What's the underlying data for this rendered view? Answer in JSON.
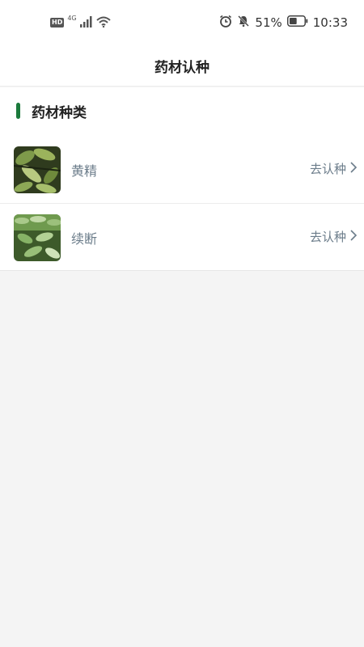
{
  "status_bar": {
    "hd": "HD",
    "network": "4G",
    "battery_percent": "51%",
    "time": "10:33",
    "battery_level": 0.51
  },
  "header": {
    "title": "药材认种"
  },
  "section": {
    "title": "药材种类"
  },
  "items": [
    {
      "name": "黄精",
      "action_label": "去认种",
      "thumb_icon": "leaf-photo"
    },
    {
      "name": "续断",
      "action_label": "去认种",
      "thumb_icon": "plant-photo"
    }
  ],
  "colors": {
    "accent": "#1b7a3c",
    "muted_text": "#6b7c8a",
    "page_bg": "#f4f4f4"
  }
}
